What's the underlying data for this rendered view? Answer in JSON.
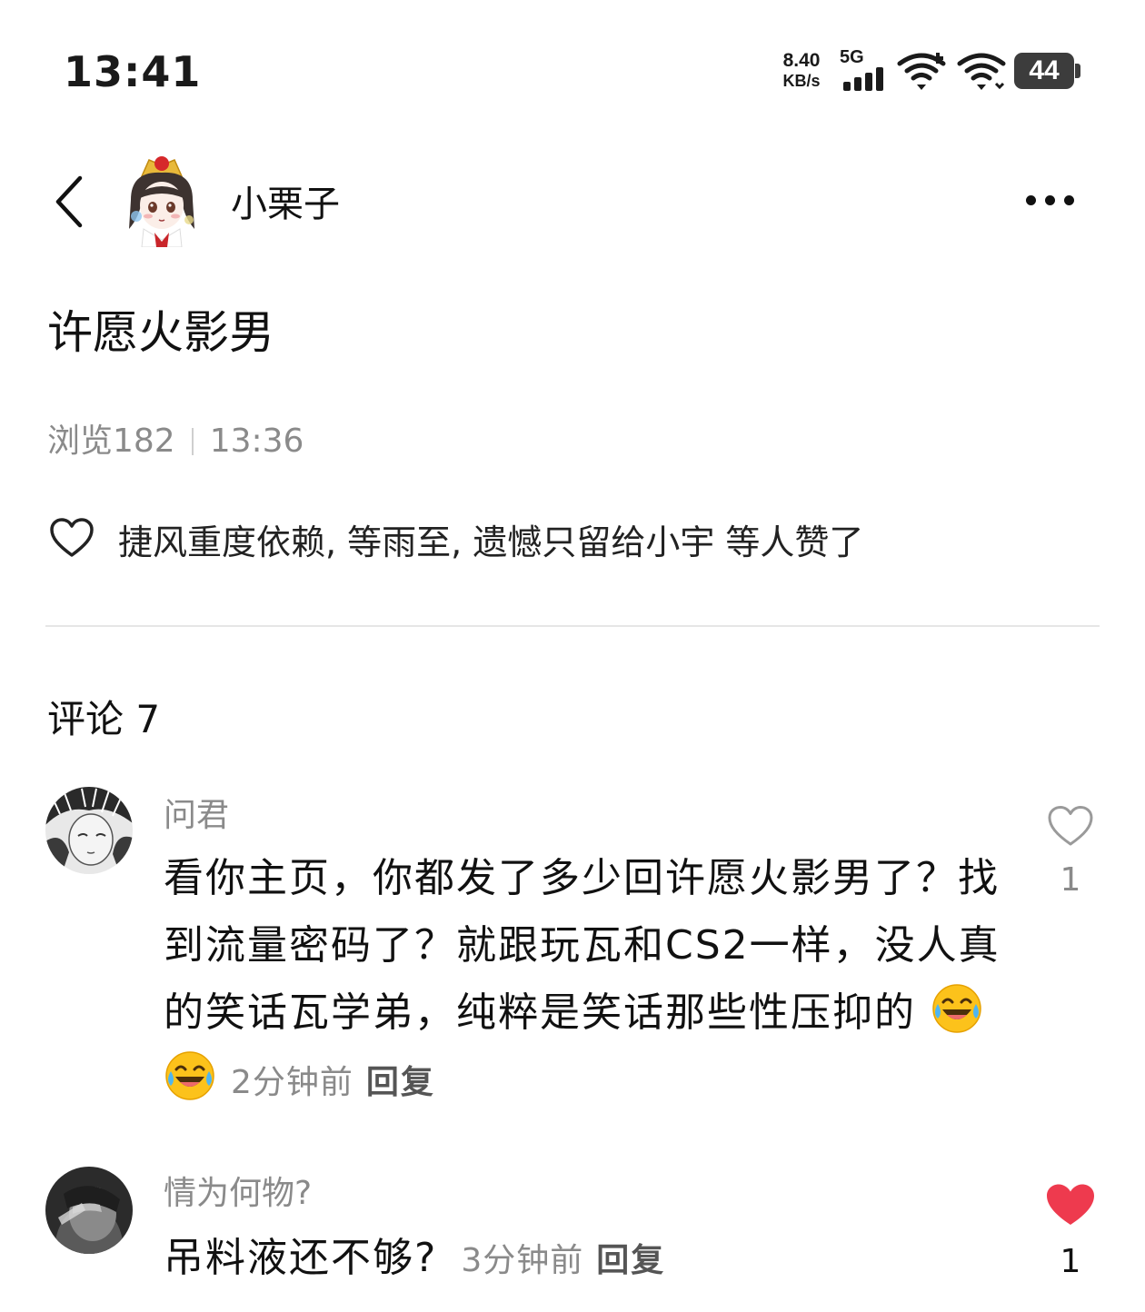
{
  "status_bar": {
    "time": "13:41",
    "net_speed_value": "8.40",
    "net_speed_unit": "KB/s",
    "network_type": "5G",
    "battery": "44"
  },
  "header": {
    "author_name": "小栗子",
    "icons": {
      "back": "back-chevron-icon",
      "more": "more-dots-icon"
    }
  },
  "post": {
    "title": "许愿火影男",
    "views": "浏览182",
    "time": "13:36",
    "likes_text": "捷风重度依赖, 等雨至, 遗憾只留给小宇 等人赞了"
  },
  "comments_heading": "评论 7",
  "comments": [
    {
      "name": "问君",
      "text": "看你主页，你都发了多少回许愿火影男了？找到流量密码了？就跟玩瓦和CS2一样，没人真的笑话瓦学弟，纯粹是笑话那些性压抑的",
      "emojis": "😂😂",
      "time": "2分钟前",
      "reply": "回复",
      "like_count": "1",
      "liked": false
    },
    {
      "name": "情为何物?",
      "text": "吊料液还不够?",
      "time": "3分钟前",
      "reply": "回复",
      "like_count": "1",
      "liked": true
    }
  ],
  "colors": {
    "liked_heart": "#ee3a4e",
    "muted_text": "#8a8a8a",
    "divider": "#e6e6e6"
  }
}
